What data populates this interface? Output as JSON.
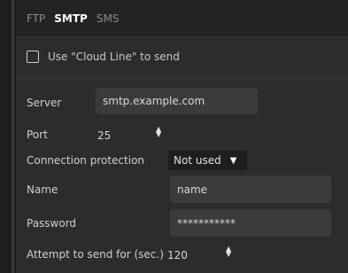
{
  "tabs": [
    {
      "label": "FTP",
      "active": false
    },
    {
      "label": "SMTP",
      "active": true
    },
    {
      "label": "SMS",
      "active": false
    }
  ],
  "cloud_line": {
    "label": "Use \"Cloud Line\" to send",
    "checked": false
  },
  "server": {
    "label": "Server",
    "value": "smtp.example.com"
  },
  "port": {
    "label": "Port",
    "value": "25"
  },
  "protection": {
    "label": "Connection protection",
    "value": "Not used"
  },
  "name": {
    "label": "Name",
    "value": "name"
  },
  "password": {
    "label": "Password",
    "value": "***********"
  },
  "attempt": {
    "label": "Attempt to send for (sec.)",
    "value": "120"
  },
  "icons": {
    "spinner": "up-down-arrows-icon",
    "dropdown": "caret-down-icon"
  }
}
